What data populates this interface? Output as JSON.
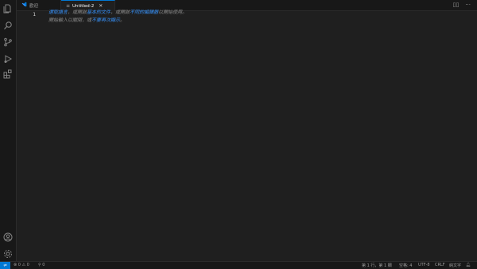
{
  "tabs": [
    {
      "label": "歡迎",
      "active": false
    },
    {
      "label": "Untitled-2",
      "active": true
    }
  ],
  "editor": {
    "line_number": "1",
    "hint_line1_pre": "選取語言",
    "hint_line1_mid1": "，或開啟",
    "hint_line1_link1": "基本的文件",
    "hint_line1_mid2": "，或開啟",
    "hint_line1_link2": "不同的編輯器",
    "hint_line1_post": "以開始使用。",
    "hint_line2_pre": "開始輸入以關閉，或",
    "hint_line2_link": "不要再次顯示",
    "hint_line2_post": "。"
  },
  "status_bar": {
    "remote_icon": "remote-icon",
    "errors": "0",
    "warnings": "0",
    "ports": "0",
    "position": "第 1 行，第 1 欄",
    "spaces": "空格: 4",
    "encoding": "UTF-8",
    "eol": "CRLF",
    "language": "純文字"
  },
  "colors": {
    "accent": "#0078d4",
    "link": "#3794ff",
    "editor_bg": "#1f1f1f",
    "chrome_bg": "#181818"
  }
}
